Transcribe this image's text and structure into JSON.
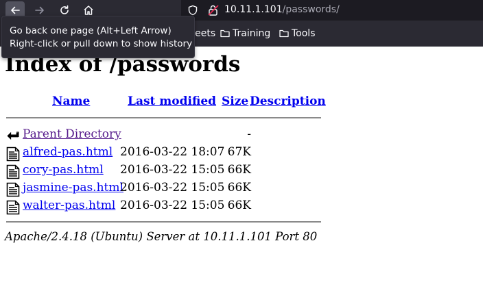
{
  "browser": {
    "url_host": "10.11.1.101",
    "url_path": "/passwords/",
    "bookmarks": [
      {
        "label": "heat sheets"
      },
      {
        "label": "Training"
      },
      {
        "label": "Tools"
      }
    ],
    "tooltip": {
      "line1": "Go back one page (Alt+Left Arrow)",
      "line2": "Right-click or pull down to show history"
    }
  },
  "page": {
    "title": "Index of /passwords",
    "columns": {
      "name": "Name",
      "last_modified": "Last modified",
      "size": "Size",
      "description": "Description"
    },
    "rows": [
      {
        "name": "Parent Directory",
        "modified": "",
        "size": "-",
        "icon": "back-arrow-icon"
      },
      {
        "name": "alfred-pas.html",
        "modified": "2016-03-22 18:07",
        "size": "67K",
        "icon": "text-file-icon"
      },
      {
        "name": "cory-pas.html",
        "modified": "2016-03-22 15:05",
        "size": "66K",
        "icon": "text-file-icon"
      },
      {
        "name": "jasmine-pas.html",
        "modified": "2016-03-22 15:05",
        "size": "66K",
        "icon": "text-file-icon"
      },
      {
        "name": "walter-pas.html",
        "modified": "2016-03-22 15:05",
        "size": "66K",
        "icon": "text-file-icon"
      }
    ],
    "footer": "Apache/2.4.18 (Ubuntu) Server at 10.11.1.101 Port 80"
  }
}
